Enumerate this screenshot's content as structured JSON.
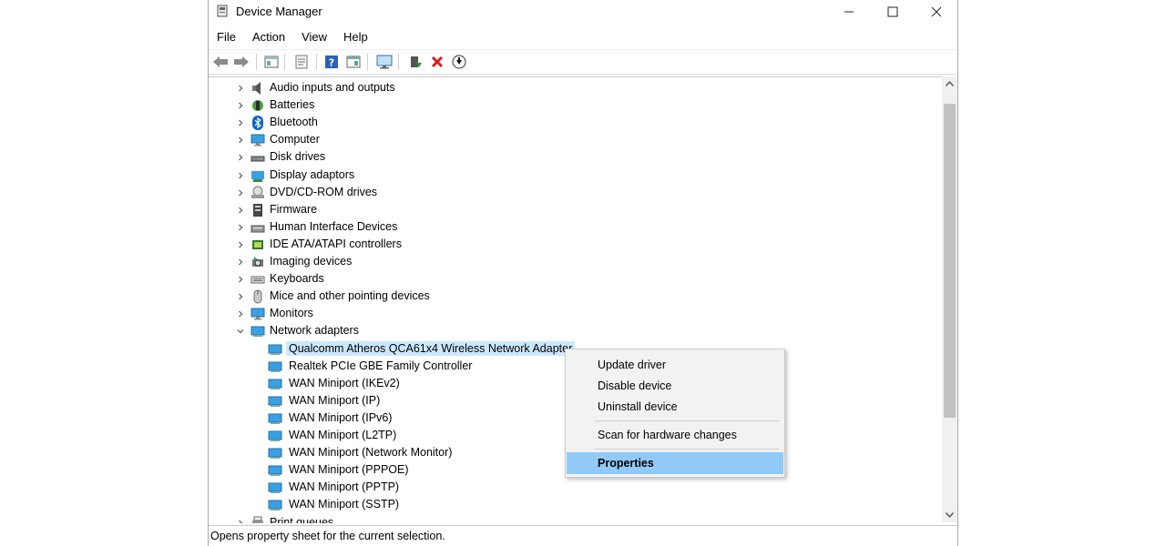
{
  "window": {
    "title": "Device Manager",
    "minimize": "—",
    "maximize": "☐",
    "close": "✕"
  },
  "menus": [
    "File",
    "Action",
    "View",
    "Help"
  ],
  "toolbar": [
    "back-icon",
    "forward-icon",
    "show-hide-tree-icon",
    "properties-icon",
    "help-icon",
    "view-icon",
    "monitor-icon",
    "enable-device-icon",
    "uninstall-icon",
    "update-driver-icon"
  ],
  "tree": {
    "categories": [
      {
        "label": "Audio inputs and outputs",
        "icon": "speaker-icon"
      },
      {
        "label": "Batteries",
        "icon": "battery-icon"
      },
      {
        "label": "Bluetooth",
        "icon": "bluetooth-icon"
      },
      {
        "label": "Computer",
        "icon": "computer-icon"
      },
      {
        "label": "Disk drives",
        "icon": "disk-icon"
      },
      {
        "label": "Display adaptors",
        "icon": "display-adaptor-icon"
      },
      {
        "label": "DVD/CD-ROM drives",
        "icon": "dvd-icon"
      },
      {
        "label": "Firmware",
        "icon": "firmware-icon"
      },
      {
        "label": "Human Interface Devices",
        "icon": "hid-icon"
      },
      {
        "label": "IDE ATA/ATAPI controllers",
        "icon": "ide-icon"
      },
      {
        "label": "Imaging devices",
        "icon": "camera-icon"
      },
      {
        "label": "Keyboards",
        "icon": "keyboard-icon"
      },
      {
        "label": "Mice and other pointing devices",
        "icon": "mouse-icon"
      },
      {
        "label": "Monitors",
        "icon": "monitor-icon"
      },
      {
        "label": "Network adapters",
        "icon": "network-icon"
      }
    ],
    "network_children": [
      "Qualcomm Atheros QCA61x4 Wireless Network Adapter",
      "Realtek PCIe GBE Family Controller",
      "WAN Miniport (IKEv2)",
      "WAN Miniport (IP)",
      "WAN Miniport (IPv6)",
      "WAN Miniport (L2TP)",
      "WAN Miniport (Network Monitor)",
      "WAN Miniport (PPPOE)",
      "WAN Miniport (PPTP)",
      "WAN Miniport (SSTP)"
    ],
    "next_category": "Print queues"
  },
  "context_menu": {
    "update_driver": "Update driver",
    "disable_device": "Disable device",
    "uninstall_device": "Uninstall device",
    "scan": "Scan for hardware changes",
    "properties": "Properties"
  },
  "status_text": "Opens property sheet for the current selection.",
  "colors": {
    "selection": "#cce8ff",
    "menu_highlight": "#91c9f7"
  }
}
